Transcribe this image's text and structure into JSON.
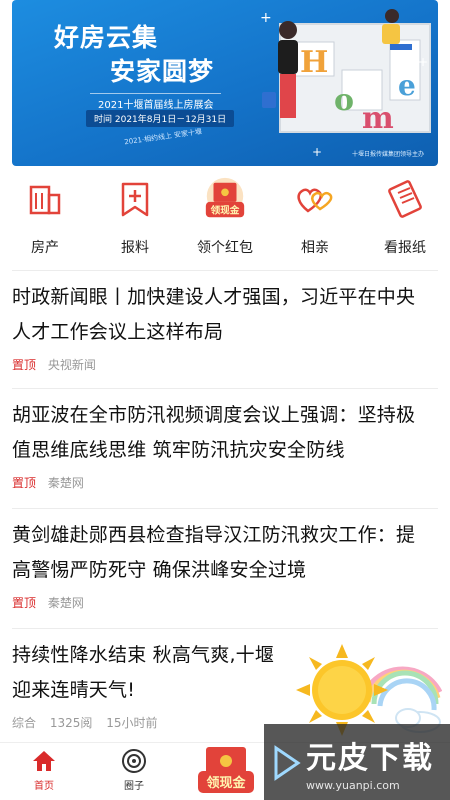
{
  "banner": {
    "title_line1": "好房云集",
    "title_line2": "安家圆梦",
    "expo_name": "2021十堰首届线上房展会",
    "expo_date": "时间 2021年8月1日－12月31日",
    "scribble": "2021·相约线上 安家十堰",
    "sponsor": "十堰日报传媒集团领导主办",
    "art_letters": "Home"
  },
  "nav": [
    {
      "label": "房产",
      "icon": "building-icon",
      "color": "#e2433a"
    },
    {
      "label": "报料",
      "icon": "report-bookmark-icon",
      "color": "#e2433a"
    },
    {
      "label": "领个红包",
      "icon": "red-envelope-icon",
      "badge": "领现金",
      "color": "#e2433a"
    },
    {
      "label": "相亲",
      "icon": "hearts-icon",
      "color": "#e2433a"
    },
    {
      "label": "看报纸",
      "icon": "newspaper-icon",
      "color": "#e2433a"
    }
  ],
  "news": [
    {
      "title": "时政新闻眼丨加快建设人才强国，习近平在中央人才工作会议上这样布局",
      "tag": "置顶",
      "source": "央视新闻"
    },
    {
      "title": "胡亚波在全市防汛视频调度会议上强调：坚持极值思维底线思维 筑牢防汛抗灾安全防线",
      "tag": "置顶",
      "source": "秦楚网"
    },
    {
      "title": "黄剑雄赴郧西县检查指导汉江防汛救灾工作：提高警惕严防死守 确保洪峰安全过境",
      "tag": "置顶",
      "source": "秦楚网"
    },
    {
      "title": "持续性降水结束 秋高气爽,十堰迎来连晴天气!",
      "category": "综合",
      "views": "1325阅",
      "time": "15小时前"
    }
  ],
  "tabs": [
    {
      "label": "首页",
      "icon": "home-icon"
    },
    {
      "label": "圈子",
      "icon": "circle-spiral-icon"
    },
    {
      "label": "领现金",
      "icon": "red-envelope-icon"
    }
  ],
  "watermark": {
    "brand": "元皮下载",
    "url": "www.yuanpi.com"
  },
  "colors": {
    "accent": "#d92b2b",
    "banner": "#1473c9"
  }
}
